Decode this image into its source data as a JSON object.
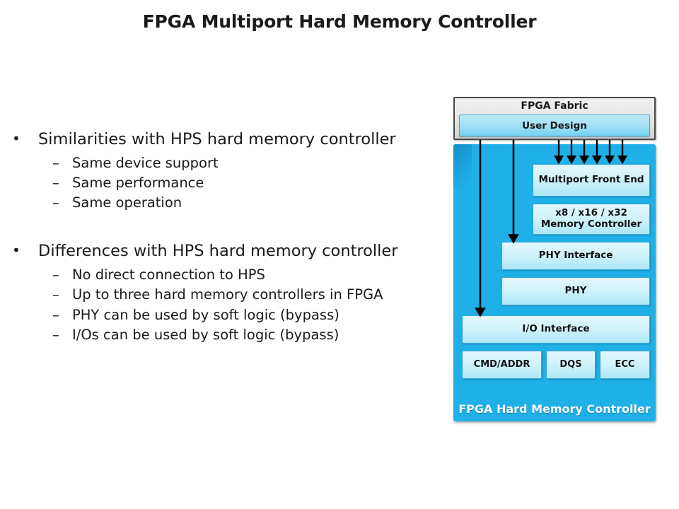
{
  "slide": {
    "title": "FPGA Multiport Hard Memory Controller",
    "bullet_marker": "•",
    "sub_marker": "–"
  },
  "body": {
    "groups": [
      {
        "heading": "Similarities with HPS hard memory controller",
        "items": [
          "Same device support",
          "Same performance",
          "Same operation"
        ]
      },
      {
        "heading": "Differences with HPS hard memory controller",
        "items": [
          "No direct connection to HPS",
          "Up to three hard memory controllers in FPGA",
          "PHY can be used by soft logic (bypass)",
          "I/Os can be used by soft logic (bypass)"
        ]
      }
    ]
  },
  "diagram": {
    "fabric": {
      "label": "FPGA Fabric",
      "user_design": "User Design"
    },
    "container_label": "FPGA Hard Memory Controller",
    "blocks": {
      "mpfe": "Multiport Front End",
      "memctrl": "x8 / x16 / x32 Memory Controller",
      "phy_interface": "PHY Interface",
      "phy": "PHY",
      "io_interface": "I/O Interface",
      "cmd_addr": "CMD/ADDR",
      "dqs": "DQS",
      "ecc": "ECC"
    },
    "colors": {
      "container_blue": "#1fb0e8",
      "block_fill_light": "#e2f8fd",
      "block_fill_dark": "#aee7f8",
      "block_border": "#36a8d6",
      "fabric_fill": "#e4e4e4",
      "fabric_border": "#4a4a4a",
      "user_design_fill": "#a3e0f6",
      "arrow": "#000000",
      "container_label_text": "#ffffff",
      "title_text": "#1a1a1a"
    },
    "arrow_counts": {
      "user_design_to_mpfe": 6,
      "user_design_to_phy_interface": 1,
      "user_design_to_io_interface": 1
    }
  }
}
